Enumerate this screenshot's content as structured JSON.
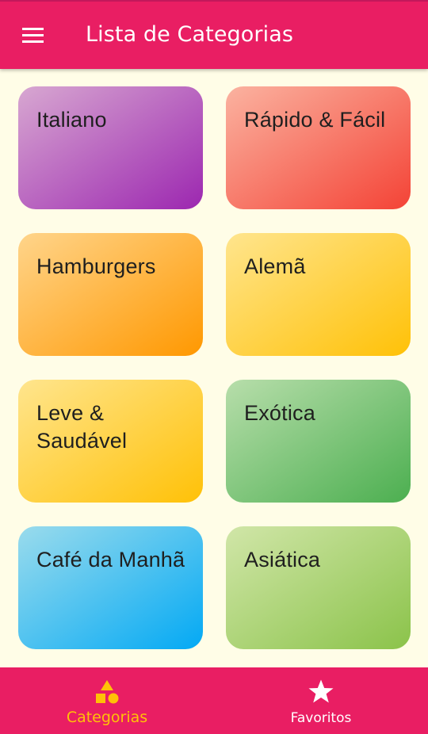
{
  "appbar": {
    "title": "Lista de Categorias",
    "menu_icon": "hamburger-menu-icon",
    "color": "#e91e63"
  },
  "background": "#fffde7",
  "categories": [
    {
      "label": "Italiano",
      "color": "#9c27b0"
    },
    {
      "label": "Rápido & Fácil",
      "color": "#f44336"
    },
    {
      "label": "Hamburgers",
      "color": "#ff9800"
    },
    {
      "label": "Alemã",
      "color": "#ffc107"
    },
    {
      "label": "Leve & Saudável",
      "color": "#ffc107"
    },
    {
      "label": "Exótica",
      "color": "#4caf50"
    },
    {
      "label": "Café da Manhã",
      "color": "#03a9f4"
    },
    {
      "label": "Asiática",
      "color": "#8bc34a"
    }
  ],
  "bottom_nav": {
    "items": [
      {
        "label": "Categorias",
        "icon": "category-shapes-icon",
        "selected": true,
        "color": "#ffc107"
      },
      {
        "label": "Favoritos",
        "icon": "star-icon",
        "selected": false,
        "color": "#ffffff"
      }
    ],
    "color": "#e91e63"
  }
}
